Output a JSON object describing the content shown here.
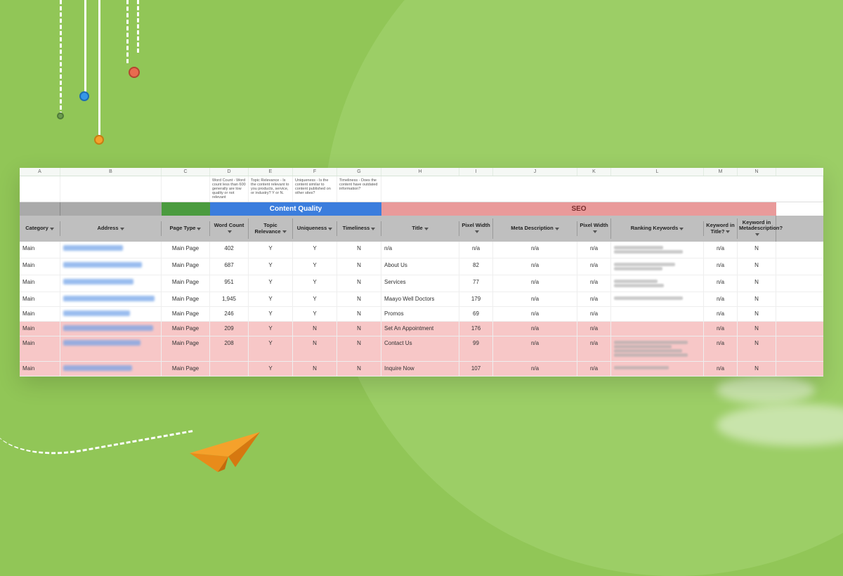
{
  "columns_letters": [
    "A",
    "B",
    "C",
    "D",
    "E",
    "F",
    "G",
    "H",
    "I",
    "J",
    "K",
    "L",
    "M",
    "N"
  ],
  "hints": {
    "word_count": "Word Count\n- Word count less than 600 generally are low quality or not relevant",
    "topic_relevance": "Topic Relevance\n- Is the content relevant to you products, service, or industry? Y or N.",
    "uniqueness": "Uniqueness\n- Is the content similar to content published on other sites?",
    "timeliness": "Timeliness\n- Does the content have outdated information?"
  },
  "sections": {
    "content_quality": "Content Quality",
    "seo": "SEO"
  },
  "headers": {
    "category": "Category",
    "address": "Address",
    "page_type": "Page Type",
    "word_count": "Word Count",
    "topic_relevance": "Topic Relevance",
    "uniqueness": "Uniqueness",
    "timeliness": "Timeliness",
    "title": "Title",
    "pixel_width_1": "Pixel Width",
    "meta_description": "Meta Description",
    "pixel_width_2": "Pixel Width",
    "ranking_keywords": "Ranking Keywords",
    "keyword_in_title": "Keyword in Title?",
    "keyword_in_meta": "Keyword in Metadescription?"
  },
  "rows": [
    {
      "cat": "Main",
      "page_type": "Main Page",
      "wc": "402",
      "tr": "Y",
      "uq": "Y",
      "tl": "N",
      "title": "n/a",
      "pw1": "n/a",
      "meta": "n/a",
      "pw2": "n/a",
      "kit": "n/a",
      "kim": "N",
      "pink": false,
      "addr_w": 85,
      "kw_lines": 2
    },
    {
      "cat": "Main",
      "page_type": "Main Page",
      "wc": "687",
      "tr": "Y",
      "uq": "Y",
      "tl": "N",
      "title": "About Us",
      "pw1": "82",
      "meta": "n/a",
      "pw2": "n/a",
      "kit": "n/a",
      "kim": "N",
      "pink": false,
      "addr_w": 112,
      "kw_lines": 2
    },
    {
      "cat": "Main",
      "page_type": "Main Page",
      "wc": "951",
      "tr": "Y",
      "uq": "Y",
      "tl": "N",
      "title": "Services",
      "pw1": "77",
      "meta": "n/a",
      "pw2": "n/a",
      "kit": "n/a",
      "kim": "N",
      "pink": false,
      "addr_w": 100,
      "kw_lines": 2
    },
    {
      "cat": "Main",
      "page_type": "Main Page",
      "wc": "1,945",
      "tr": "Y",
      "uq": "Y",
      "tl": "N",
      "title": "Maayo Well Doctors",
      "pw1": "179",
      "meta": "n/a",
      "pw2": "n/a",
      "kit": "n/a",
      "kim": "N",
      "pink": false,
      "addr_w": 130,
      "kw_lines": 1
    },
    {
      "cat": "Main",
      "page_type": "Main Page",
      "wc": "246",
      "tr": "Y",
      "uq": "Y",
      "tl": "N",
      "title": "Promos",
      "pw1": "69",
      "meta": "n/a",
      "pw2": "n/a",
      "kit": "n/a",
      "kim": "N",
      "pink": false,
      "addr_w": 95,
      "kw_lines": 0
    },
    {
      "cat": "Main",
      "page_type": "Main Page",
      "wc": "209",
      "tr": "Y",
      "uq": "N",
      "tl": "N",
      "title": "Set An Appointment",
      "pw1": "176",
      "meta": "n/a",
      "pw2": "n/a",
      "kit": "n/a",
      "kim": "N",
      "pink": true,
      "addr_w": 128,
      "kw_lines": 0
    },
    {
      "cat": "Main",
      "page_type": "Main Page",
      "wc": "208",
      "tr": "Y",
      "uq": "N",
      "tl": "N",
      "title": "Contact Us",
      "pw1": "99",
      "meta": "n/a",
      "pw2": "n/a",
      "kit": "n/a",
      "kim": "N",
      "pink": true,
      "addr_w": 110,
      "kw_lines": 4
    },
    {
      "cat": "Main",
      "page_type": "Main Page",
      "wc": "",
      "tr": "Y",
      "uq": "N",
      "tl": "N",
      "title": "Inquire Now",
      "pw1": "107",
      "meta": "n/a",
      "pw2": "n/a",
      "kit": "n/a",
      "kim": "N",
      "pink": true,
      "addr_w": 98,
      "kw_lines": 1
    }
  ]
}
